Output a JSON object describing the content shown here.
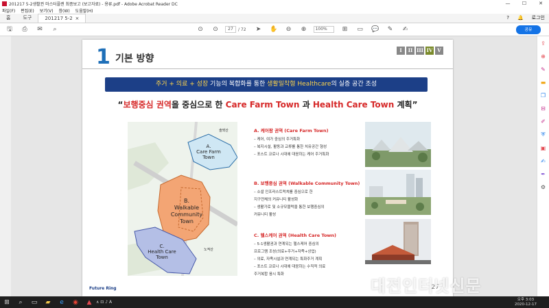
{
  "window": {
    "title": "201217 5-2생활권 마스터플랜 최종보고 (보고자료) - 용류.pdf - Adobe Acrobat Reader DC",
    "controls": [
      "—",
      "☐",
      "✕"
    ]
  },
  "menu": [
    "파일(F)",
    "편집(E)",
    "보기(V)",
    "창(W)",
    "도움말(H)"
  ],
  "tabs": {
    "home": "홈",
    "tools": "도구",
    "doc": "201217 5-2생활권 ...",
    "doc_close": "×",
    "login": "로그인"
  },
  "toolbar": {
    "page_current": "27",
    "page_total": "/ 72",
    "zoom": "100%",
    "share": "공유"
  },
  "slide": {
    "number": "1",
    "heading": "기본 방향",
    "roman": [
      "I",
      "II",
      "III",
      "IV",
      "V"
    ],
    "banner": {
      "a": "주거 + 의료 + 성장",
      "b": " 기능의 복합화를 통한 ",
      "c": "생활밀착형 Healthcare",
      "d": "의 실증 공간 조성"
    },
    "quote": {
      "q1": "“",
      "p1": "보행중심 권역",
      "p2": "을 중심으로 한 ",
      "p3": "Care Farm Town",
      "p4": " 과 ",
      "p5": "Health Care Town",
      "p6": " 계획",
      "q2": "”"
    },
    "map": {
      "a_title": "A.",
      "a1": "Care Farm",
      "a2": "Town",
      "b_title": "B.",
      "b1": "Walkable",
      "b2": "Community",
      "b3": "Town",
      "c_title": "C.",
      "c1": "Health Care",
      "c2": "Town",
      "label_north": "솔뫼산",
      "label_south": "노적산"
    },
    "sections": [
      {
        "title": "A. 케어팜 권역 (Care Farm Town)",
        "items": [
          "– 케어, 여가 중심의 주거특화",
          "– 복지시설, 활동과 교류를 통한 치유공간 형성",
          "– 포스트 코로나 시대에 대응하는 케어 주거특화"
        ]
      },
      {
        "title": "B. 보행중심 권역 (Walkable Community Town)",
        "items": [
          "– 소셜 인프라스트럭쳐를 중심으로 한",
          "   지구전체의 커뮤니티 활성화",
          "– 생활가로 및 소규모블럭을 통한 보행중심의",
          "   커뮤니티 활성"
        ]
      },
      {
        "title": "C. 헬스케어 권역 (Health Care Town)",
        "items": [
          "– 5-1생활권과 연계되는 헬스케어 중심의",
          "   프로그램 조성(의료+주거+자족+상업)",
          "– 의료, 자족시설과 연계되는 특화주거 계획",
          "– 포스트 코로나 시대에 대응하는 수직적 의료",
          "   주거복합 융시 특화"
        ]
      }
    ],
    "page_number": "27",
    "footer_logo": "Future Ring"
  },
  "watermark": "대전인터넷신문",
  "taskbar": {
    "time": "오후 3:03",
    "date": "2020-12-17",
    "tray": "∧ ⊡ ♪ A"
  }
}
